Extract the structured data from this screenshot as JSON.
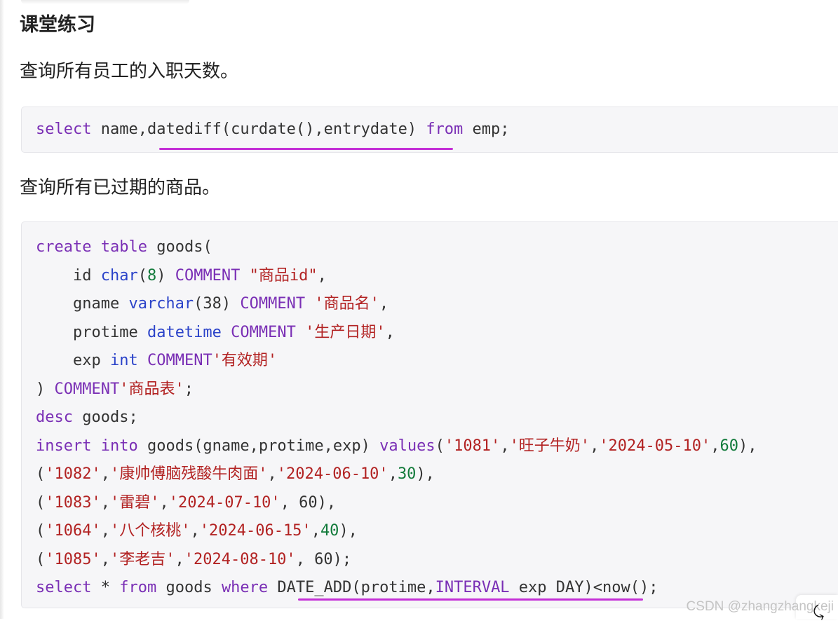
{
  "heading": "课堂练习",
  "paragraphs": {
    "p1": "查询所有员工的入职天数。",
    "p2": "查询所有已过期的商品。"
  },
  "code_block_1": {
    "lines": [
      [
        {
          "t": "select",
          "c": "kw"
        },
        {
          "t": " name,datediff(curdate(),entrydate) ",
          "c": "plain"
        },
        {
          "t": "from",
          "c": "kw"
        },
        {
          "t": " emp;",
          "c": "plain"
        }
      ]
    ]
  },
  "code_block_2": {
    "lines": [
      [
        {
          "t": "create",
          "c": "kw"
        },
        {
          "t": " ",
          "c": "plain"
        },
        {
          "t": "table",
          "c": "kw"
        },
        {
          "t": " goods(",
          "c": "plain"
        }
      ],
      [
        {
          "t": "    id ",
          "c": "plain"
        },
        {
          "t": "char",
          "c": "typ"
        },
        {
          "t": "(",
          "c": "plain"
        },
        {
          "t": "8",
          "c": "num"
        },
        {
          "t": ") ",
          "c": "plain"
        },
        {
          "t": "COMMENT",
          "c": "cmt"
        },
        {
          "t": " ",
          "c": "plain"
        },
        {
          "t": "\"商品id\"",
          "c": "str"
        },
        {
          "t": ",",
          "c": "plain"
        }
      ],
      [
        {
          "t": "    gname ",
          "c": "plain"
        },
        {
          "t": "varchar",
          "c": "typ"
        },
        {
          "t": "(38) ",
          "c": "plain"
        },
        {
          "t": "COMMENT",
          "c": "cmt"
        },
        {
          "t": " ",
          "c": "plain"
        },
        {
          "t": "'商品名'",
          "c": "str"
        },
        {
          "t": ",",
          "c": "plain"
        }
      ],
      [
        {
          "t": "    protime ",
          "c": "plain"
        },
        {
          "t": "datetime",
          "c": "typ"
        },
        {
          "t": " ",
          "c": "plain"
        },
        {
          "t": "COMMENT",
          "c": "cmt"
        },
        {
          "t": " ",
          "c": "plain"
        },
        {
          "t": "'生产日期'",
          "c": "str"
        },
        {
          "t": ",",
          "c": "plain"
        }
      ],
      [
        {
          "t": "    exp ",
          "c": "plain"
        },
        {
          "t": "int",
          "c": "typ"
        },
        {
          "t": " ",
          "c": "plain"
        },
        {
          "t": "COMMENT",
          "c": "cmt"
        },
        {
          "t": "'有效期'",
          "c": "str"
        }
      ],
      [
        {
          "t": ") ",
          "c": "plain"
        },
        {
          "t": "COMMENT",
          "c": "cmt"
        },
        {
          "t": "'商品表'",
          "c": "str"
        },
        {
          "t": ";",
          "c": "plain"
        }
      ],
      [
        {
          "t": "desc",
          "c": "kw"
        },
        {
          "t": " goods;",
          "c": "plain"
        }
      ],
      [
        {
          "t": "insert",
          "c": "kw"
        },
        {
          "t": " ",
          "c": "plain"
        },
        {
          "t": "into",
          "c": "kw"
        },
        {
          "t": " goods(gname,protime,exp) ",
          "c": "plain"
        },
        {
          "t": "values",
          "c": "kw"
        },
        {
          "t": "(",
          "c": "plain"
        },
        {
          "t": "'1081'",
          "c": "str"
        },
        {
          "t": ",",
          "c": "plain"
        },
        {
          "t": "'旺子牛奶'",
          "c": "str"
        },
        {
          "t": ",",
          "c": "plain"
        },
        {
          "t": "'2024-05-10'",
          "c": "str"
        },
        {
          "t": ",",
          "c": "plain"
        },
        {
          "t": "60",
          "c": "num"
        },
        {
          "t": "),",
          "c": "plain"
        }
      ],
      [
        {
          "t": "(",
          "c": "plain"
        },
        {
          "t": "'1082'",
          "c": "str"
        },
        {
          "t": ",",
          "c": "plain"
        },
        {
          "t": "'康帅傅脑残酸牛肉面'",
          "c": "str"
        },
        {
          "t": ",",
          "c": "plain"
        },
        {
          "t": "'2024-06-10'",
          "c": "str"
        },
        {
          "t": ",",
          "c": "plain"
        },
        {
          "t": "30",
          "c": "num"
        },
        {
          "t": "),",
          "c": "plain"
        }
      ],
      [
        {
          "t": "(",
          "c": "plain"
        },
        {
          "t": "'1083'",
          "c": "str"
        },
        {
          "t": ",",
          "c": "plain"
        },
        {
          "t": "'雷碧'",
          "c": "str"
        },
        {
          "t": ",",
          "c": "plain"
        },
        {
          "t": "'2024-07-10'",
          "c": "str"
        },
        {
          "t": ", 60),",
          "c": "plain"
        }
      ],
      [
        {
          "t": "(",
          "c": "plain"
        },
        {
          "t": "'1064'",
          "c": "str"
        },
        {
          "t": ",",
          "c": "plain"
        },
        {
          "t": "'八个核桃'",
          "c": "str"
        },
        {
          "t": ",",
          "c": "plain"
        },
        {
          "t": "'2024-06-15'",
          "c": "str"
        },
        {
          "t": ",",
          "c": "plain"
        },
        {
          "t": "40",
          "c": "num"
        },
        {
          "t": "),",
          "c": "plain"
        }
      ],
      [
        {
          "t": "(",
          "c": "plain"
        },
        {
          "t": "'1085'",
          "c": "str"
        },
        {
          "t": ",",
          "c": "plain"
        },
        {
          "t": "'李老吉'",
          "c": "str"
        },
        {
          "t": ",",
          "c": "plain"
        },
        {
          "t": "'2024-08-10'",
          "c": "str"
        },
        {
          "t": ", 60);",
          "c": "plain"
        }
      ],
      [
        {
          "t": "select",
          "c": "kw"
        },
        {
          "t": " * ",
          "c": "plain"
        },
        {
          "t": "from",
          "c": "kw"
        },
        {
          "t": " goods ",
          "c": "plain"
        },
        {
          "t": "where",
          "c": "kw"
        },
        {
          "t": " DATE_ADD(protime,",
          "c": "plain"
        },
        {
          "t": "INTERVAL",
          "c": "cmt"
        },
        {
          "t": " exp DAY)<now();",
          "c": "plain"
        }
      ]
    ]
  },
  "watermark": "CSDN @zhangzhangkeji",
  "colors": {
    "keyword": "#7a2fb5",
    "type": "#2b43c9",
    "string": "#b22222",
    "number": "#117a3a",
    "underline": "#c42fd6"
  }
}
